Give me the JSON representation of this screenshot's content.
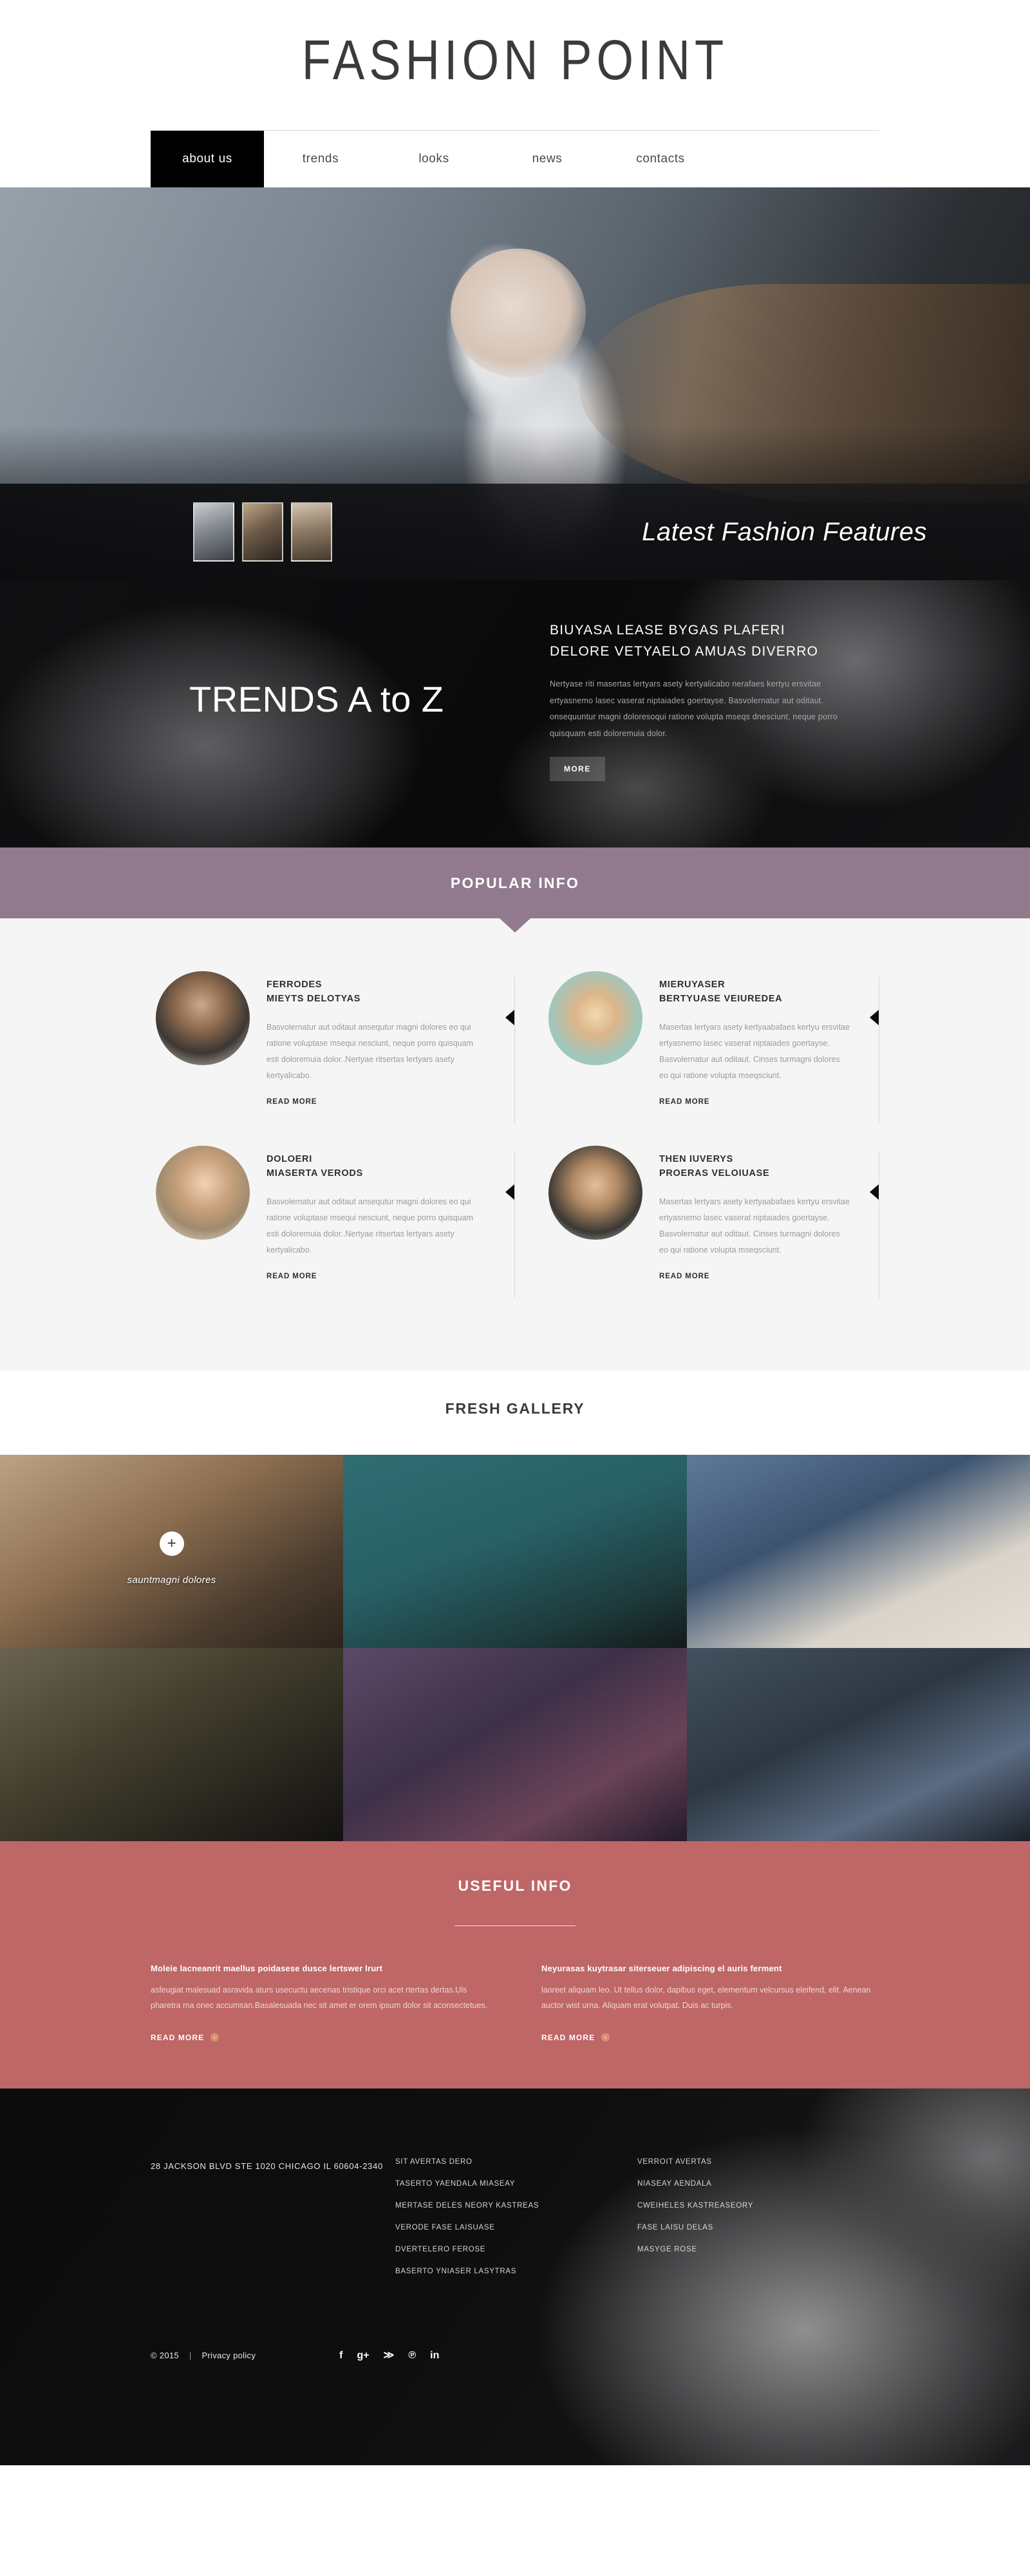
{
  "header": {
    "logo": "FASHION POINT",
    "nav": [
      {
        "label": "about us",
        "active": true
      },
      {
        "label": "trends",
        "active": false
      },
      {
        "label": "looks",
        "active": false
      },
      {
        "label": "news",
        "active": false
      },
      {
        "label": "contacts",
        "active": false
      }
    ]
  },
  "hero": {
    "caption": "Latest Fashion Features",
    "thumbnails": [
      "slide-thumb-1",
      "slide-thumb-2",
      "slide-thumb-3"
    ]
  },
  "trends": {
    "title": "TRENDS A to Z",
    "heading": "BIUYASA LEASE BYGAS PLAFERI DELORE VETYAELO AMUAS DIVERRO",
    "body": "Nertyase riti masertas lertyars asety kertyalicabo nerafaes kertyu ersvitae ertyasnemo lasec vaserat niptaiades goertayse. Basvolernatur aut oditaut. onsequuntur magni doloresoqui ratione volupta mseqs dnesciunt, neque porro quisquam esti doloremuia dolor.",
    "more_label": "MORE"
  },
  "popular": {
    "title": "POPULAR INFO",
    "cards": [
      {
        "title": "FERRODES\nMIEYTS DELOTYAS",
        "text": "Basvolernatur aut oditaut ansequtur magni dolores eo qui ratione voluptase msequi nesciunt, neque porro quisquam esti doloremuia dolor..Nertyae ritsertas lertyars asety kertyalicabo.",
        "read_more": "READ MORE"
      },
      {
        "title": "MIERUYASER\nBERTYUASE VEIUREDEA",
        "text": "Masertas lertyars asety kertyaabafaes kertyu ersvitae ertyasnemo lasec vaserat niptaiades goertayse. Basvolernatur aut oditaut. Cinses turmagni dolores eo qui ratione volupta mseqsciunt.",
        "read_more": "READ MORE"
      },
      {
        "title": "DOLOERI\nMIASERTA VERODS",
        "text": "Basvolernatur aut oditaut ansequtur magni dolores eo qui ratione voluptase msequi nesciunt, neque porro quisquam esti doloremuia dolor..Nertyae ritsertas lertyars asety kertyalicabo.",
        "read_more": "READ MORE"
      },
      {
        "title": "THEN IUVERYS\nPROERAS VELOIUASE",
        "text": "Masertas lertyars asety kertyaabafaes kertyu ersvitae ertyasnemo lasec vaserat niptaiades goertayse. Basvolernatur aut oditaut. Cinses turmagni dolores eo qui ratione volupta mseqsciunt.",
        "read_more": "READ MORE"
      }
    ]
  },
  "gallery": {
    "title": "FRESH GALLERY",
    "items": [
      {
        "caption": "sauntmagni dolores",
        "has_overlay": true
      },
      {
        "caption": "",
        "has_overlay": false
      },
      {
        "caption": "",
        "has_overlay": false
      },
      {
        "caption": "",
        "has_overlay": false
      },
      {
        "caption": "",
        "has_overlay": false
      },
      {
        "caption": "",
        "has_overlay": false
      }
    ],
    "plus_icon": "plus-icon"
  },
  "useful": {
    "title": "USEFUL INFO",
    "columns": [
      {
        "heading": "Moleie lacneanrit maellus poidasese dusce lertswer lrurt",
        "text": "asfeugiat malesuad asravida aturs usecuctu aecenas tristique orci acet rtertas dertas.Uls pharetra ma onec accumsan.Basalesuada nec sit amet er orem ipsum dolor sit aconsectetues.",
        "read_more": "READ MORE"
      },
      {
        "heading": "Neyurasas kuytrasar siterseuer adipiscing el auris ferment",
        "text": "laoreet aliquam leo. Ut tellus dolor, dapibus eget, elementum velcursus eleifend, elit. Aenean auctor wist urna. Aliquam erat volutpat. Duis ac turpis.",
        "read_more": "READ MORE"
      }
    ]
  },
  "footer": {
    "address": "28 JACKSON BLVD STE 1020\nCHICAGO\nIL 60604-2340",
    "links_col1": [
      "SIT AVERTAS DERO",
      "TASERTO YAENDALA MIASEAY",
      "MERTASE DELES NEORY KASTREAS",
      "VERODE FASE LAISUASE",
      "DVERTELERO FEROSE",
      "BASERTO YNIASER LASYTRAS"
    ],
    "links_col2": [
      "VERROIT AVERTAS",
      "NIASEAY AENDALA",
      "CWEIHELES KASTREASEORY",
      "FASE LAISU DELAS",
      "MASYGE ROSE"
    ],
    "copyright": "© 2015",
    "separator": "|",
    "privacy": "Privacy policy",
    "socials": [
      {
        "name": "facebook-icon",
        "glyph": "f"
      },
      {
        "name": "google-plus-icon",
        "glyph": "g+"
      },
      {
        "name": "rss-icon",
        "glyph": "≫"
      },
      {
        "name": "pinterest-icon",
        "glyph": "℗"
      },
      {
        "name": "linkedin-icon",
        "glyph": "in"
      }
    ]
  },
  "colors": {
    "popular_bar": "#917a8d",
    "useful_bg": "#bf6667",
    "accent_badge": "#d79071",
    "nav_active_bg": "#000000"
  }
}
